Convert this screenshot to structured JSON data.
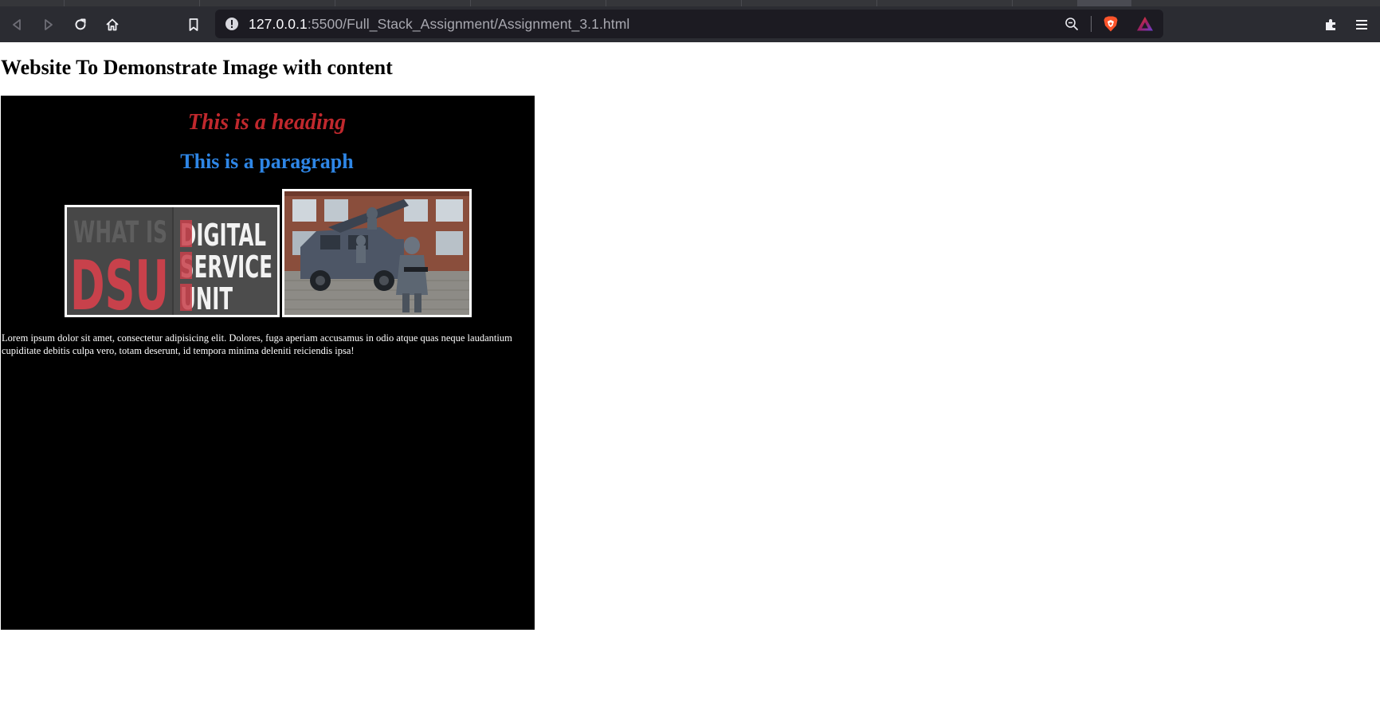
{
  "browser": {
    "url_host": "127.0.0.1",
    "url_rest": ":5500/Full_Stack_Assignment/Assignment_3.1.html",
    "icons": [
      "back-icon",
      "forward-icon",
      "reload-icon",
      "home-icon",
      "bookmark-icon",
      "site-info-icon",
      "zoom-out-icon",
      "brave-shield-icon",
      "brave-rewards-icon",
      "extensions-icon",
      "menu-icon"
    ],
    "colors": {
      "toolbar": "#2b2c32",
      "urlbar": "#1c1b22",
      "tabstrip": "#35363a"
    }
  },
  "page": {
    "title": "Website To Demonstrate Image with content",
    "box": {
      "heading": "This is a heading",
      "paragraph": "This is a paragraph",
      "images": [
        {
          "name": "dsu-logo-image",
          "logo_text": [
            "WHAT IS",
            "DSU",
            "DIGITAL",
            "SERVICE",
            "UNIT"
          ]
        },
        {
          "name": "armored-vehicle-photo"
        }
      ],
      "lorem": "Lorem ipsum dolor sit amet, consectetur adipisicing elit. Dolores, fuga aperiam accusamus in odio atque quas neque laudantium cupiditate debitis culpa vero, totam deserunt, id tempora minima deleniti reiciendis ipsa!"
    },
    "colors": {
      "box_background": "#000000",
      "heading": "#c0282d",
      "paragraph": "#2e86e6",
      "text": "#ffffff"
    }
  }
}
